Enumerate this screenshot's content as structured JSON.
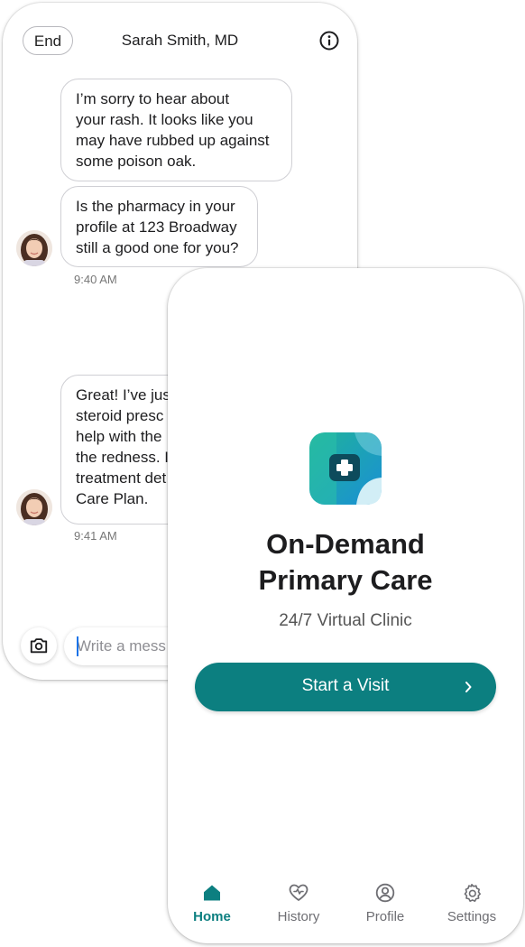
{
  "chat": {
    "end_label": "End",
    "title": "Sarah Smith, MD",
    "messages": [
      {
        "text": "I’m sorry to hear about\nyour rash. It looks like you\nmay have rubbed up against\nsome poison oak."
      },
      {
        "text": "Is the pharmacy in your\nprofile at 123 Broadway\nstill a good one for you?",
        "time": "9:40 AM"
      },
      {
        "text": "Great! I’ve jus\nsteroid presc\nhelp with the\nthe redness. I\ntreatment det\nCare Plan.",
        "time": "9:41 AM"
      }
    ],
    "input_placeholder": "Write a mess"
  },
  "home": {
    "title": "On-Demand\nPrimary Care",
    "subtitle": "24/7 Virtual Clinic",
    "start_label": "Start a Visit",
    "tabs": [
      {
        "label": "Home",
        "icon": "home-icon",
        "active": true
      },
      {
        "label": "History",
        "icon": "heart-icon",
        "active": false
      },
      {
        "label": "Profile",
        "icon": "person-icon",
        "active": false
      },
      {
        "label": "Settings",
        "icon": "gear-icon",
        "active": false
      }
    ]
  },
  "colors": {
    "accent": "#0c7f80",
    "logo_gradient_start": "#1fb39a",
    "logo_gradient_end": "#1a8fd6"
  }
}
